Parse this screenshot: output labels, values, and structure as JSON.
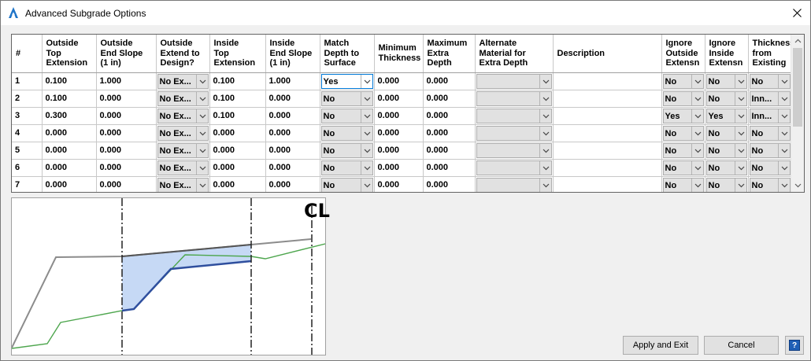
{
  "window": {
    "title": "Advanced Subgrade Options"
  },
  "columns": [
    "#",
    "Outside\nTop\nExtension",
    "Outside\nEnd Slope\n(1 in)",
    "Outside\nExtend to\nDesign?",
    "Inside\nTop\nExtension",
    "Inside\nEnd Slope\n(1 in)",
    "Match\nDepth to\nSurface",
    "Minimum\nThickness",
    "Maximum\nExtra\nDepth",
    "Alternate\nMaterial for\nExtra Depth",
    "Description",
    "Ignore\nOutside\nExtensn",
    "Ignore\nInside\nExtensn",
    "Thickness\nfrom\nExisting"
  ],
  "rows": [
    [
      "1",
      "0.100",
      "1.000",
      "No Ex...",
      "0.100",
      "1.000",
      "Yes",
      "0.000",
      "0.000",
      "",
      "",
      "No",
      "No",
      "No"
    ],
    [
      "2",
      "0.100",
      "0.000",
      "No Ex...",
      "0.100",
      "0.000",
      "No",
      "0.000",
      "0.000",
      "",
      "",
      "No",
      "No",
      "Inn..."
    ],
    [
      "3",
      "0.300",
      "0.000",
      "No Ex...",
      "0.100",
      "0.000",
      "No",
      "0.000",
      "0.000",
      "",
      "",
      "Yes",
      "Yes",
      "Inn..."
    ],
    [
      "4",
      "0.000",
      "0.000",
      "No Ex...",
      "0.000",
      "0.000",
      "No",
      "0.000",
      "0.000",
      "",
      "",
      "No",
      "No",
      "No"
    ],
    [
      "5",
      "0.000",
      "0.000",
      "No Ex...",
      "0.000",
      "0.000",
      "No",
      "0.000",
      "0.000",
      "",
      "",
      "No",
      "No",
      "No"
    ],
    [
      "6",
      "0.000",
      "0.000",
      "No Ex...",
      "0.000",
      "0.000",
      "No",
      "0.000",
      "0.000",
      "",
      "",
      "No",
      "No",
      "No"
    ],
    [
      "7",
      "0.000",
      "0.000",
      "No Ex...",
      "0.000",
      "0.000",
      "No",
      "0.000",
      "0.000",
      "",
      "",
      "No",
      "No",
      "No"
    ]
  ],
  "combo_columns": [
    3,
    6,
    9,
    11,
    12,
    13
  ],
  "selected_cell": {
    "row": 0,
    "col": 6
  },
  "preview": {
    "centerline_label": "CL"
  },
  "buttons": {
    "apply_exit": "Apply and Exit",
    "cancel": "Cancel",
    "help": "?"
  },
  "colors": {
    "fill": "#c6d9f5",
    "subgrade_line": "#2f4f9e",
    "existing_ground": "#4ea64e",
    "design_surface": "#8c8c8c"
  }
}
